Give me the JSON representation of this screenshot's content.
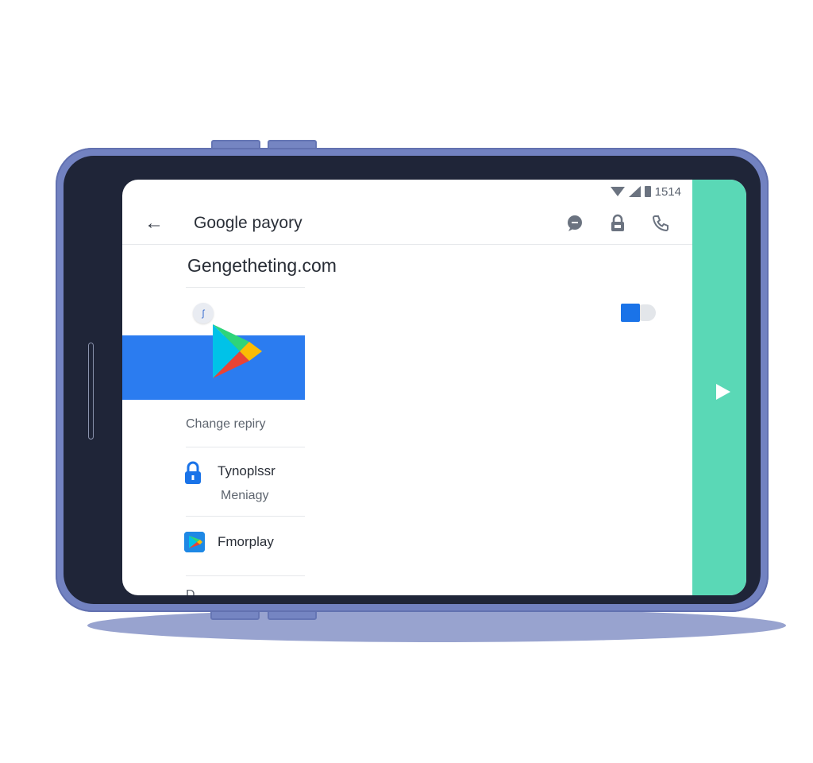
{
  "status_bar": {
    "time": "1514"
  },
  "app_bar": {
    "title": "Google payory",
    "back_icon": "arrow-back-icon"
  },
  "section": {
    "title": "Gengetheting.com"
  },
  "chip": {
    "symbol": "ʃ"
  },
  "list": {
    "header": "Change repiry",
    "items": [
      {
        "title": "Tynoplssr",
        "subtitle": "Meniagy",
        "icon": "lock-icon"
      },
      {
        "title": "Fmorplay",
        "icon": "play-store-icon"
      }
    ],
    "cut_off_label": "D..."
  },
  "colors": {
    "phone_frame": "#7282c1",
    "bezel": "#1f2538",
    "banner": "#2b7cf0",
    "side_panel": "#5ad8b6",
    "toggle": "#1a73e8"
  },
  "toggle": {
    "state": "on"
  }
}
